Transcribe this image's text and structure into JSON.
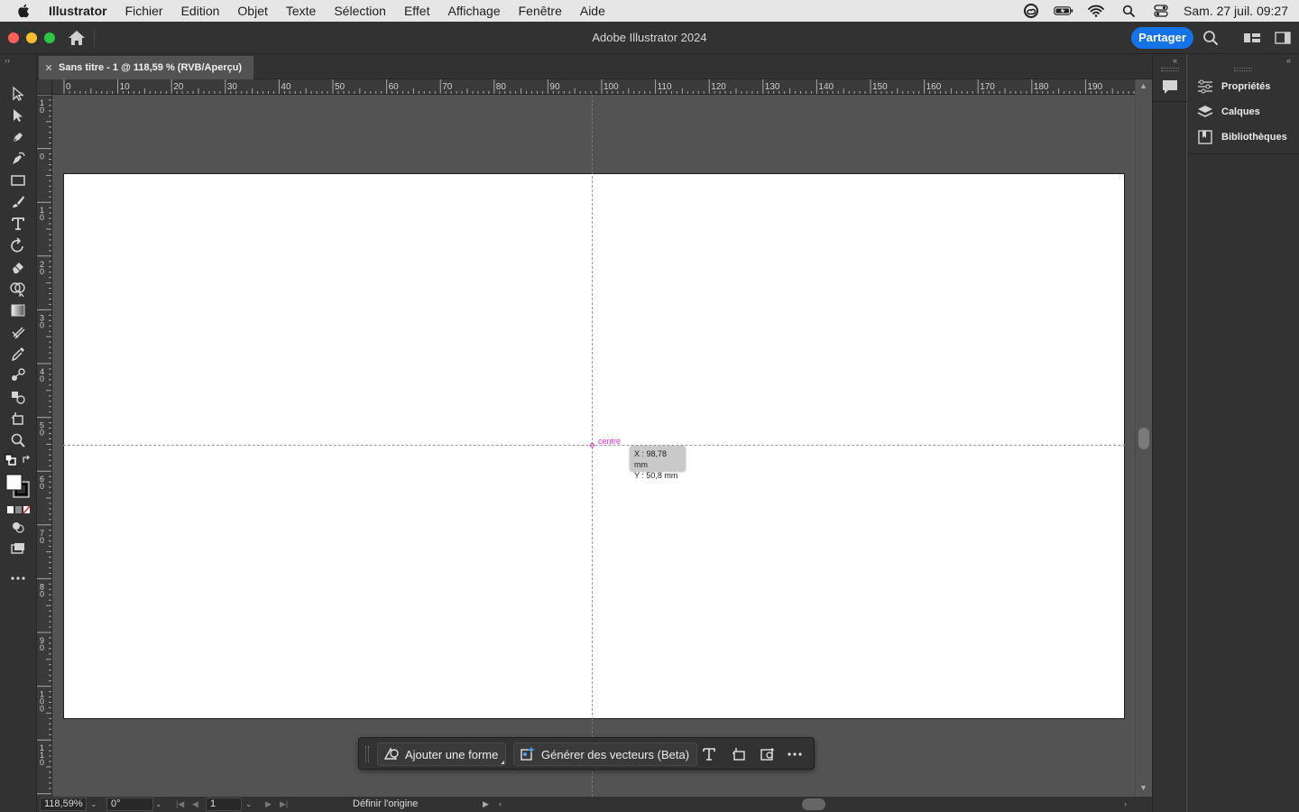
{
  "menubar": {
    "apple_icon": "apple-logo-icon",
    "items": [
      "Illustrator",
      "Fichier",
      "Edition",
      "Objet",
      "Texte",
      "Sélection",
      "Effet",
      "Affichage",
      "Fenêtre",
      "Aide"
    ],
    "clock": "Sam. 27 juil.  09:27",
    "status_icons": [
      "creative-cloud-icon",
      "battery-icon",
      "wifi-icon",
      "spotlight-search-icon",
      "control-center-icon"
    ]
  },
  "window": {
    "title": "Adobe Illustrator 2024",
    "share_label": "Partager",
    "colors": {
      "share": "#1473e6",
      "close": "#ff5f57",
      "minimize": "#febc2e",
      "maximize": "#28c840"
    }
  },
  "document": {
    "tab_label": "Sans titre - 1 @ 118,59 % (RVB/Aperçu)"
  },
  "rulers": {
    "horizontal": [
      "0",
      "10",
      "20",
      "30",
      "40",
      "50",
      "60",
      "70",
      "80",
      "90",
      "100",
      "110",
      "120",
      "130",
      "140",
      "150",
      "160",
      "170",
      "180",
      "190"
    ],
    "vertical": [
      "1 0",
      "0",
      "1 0",
      "2 0",
      "3 0",
      "4 0",
      "5 0",
      "6 0",
      "7 0",
      "8 0",
      "9 0",
      "1 0 0",
      "1 1 0"
    ]
  },
  "canvas": {
    "smart_guide_label": "centre",
    "tooltip": {
      "x": "X : 98,78 mm",
      "y": "Y : 50,8 mm"
    },
    "guide_color": "#e02fe0"
  },
  "taskbar": {
    "add_shape": "Ajouter une forme",
    "generate_vectors": "Générer des vecteurs (Beta)"
  },
  "statusbar": {
    "zoom": "118,59%",
    "rotation": "0°",
    "artboard_number": "1",
    "status_text": "Définir l'origine"
  },
  "panels": {
    "items": [
      {
        "label": "Propriétés",
        "icon": "properties-sliders-icon"
      },
      {
        "label": "Calques",
        "icon": "layers-icon"
      },
      {
        "label": "Bibliothèques",
        "icon": "libraries-icon"
      }
    ]
  }
}
